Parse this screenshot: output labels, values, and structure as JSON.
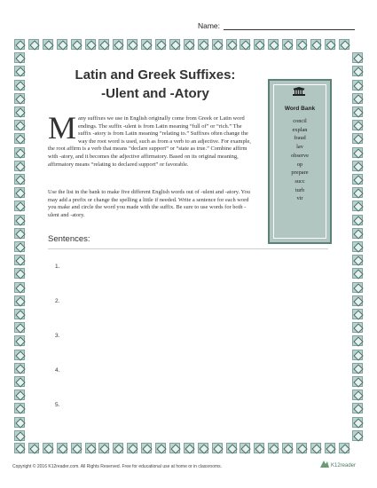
{
  "header": {
    "name_label": "Name:"
  },
  "title": {
    "line1": "Latin and Greek Suffixes:",
    "line2": "-Ulent and -Atory"
  },
  "intro": {
    "drop_cap": "M",
    "text": "any suffixes we use in English originally come from Greek or Latin word endings. The suffix -ulent is from Latin meaning “full of” or “rich.” The suffix -atory is from Latin meaning “relating to.” Suffixes often change the way the root word is used, such as from a verb to an adjective. For example, the root affirm is a verb that means “declare support” or “state as true.” Combine affirm with -atory, and it becomes the adjective affirmatory. Based on its original meaning, affirmatory means “relating to declared support” or favorable."
  },
  "instructions": "Use the list in the bank to make five different English words out of -ulent and -atory. You may add a prefix or change the spelling a little if needed. Write a sentence for each word you make and circle the word you made with the suffix. Be sure to use words for both -ulent and -atory.",
  "word_bank": {
    "title": "Word Bank",
    "icon": "bank-building-icon",
    "words": [
      "concil",
      "explan",
      "fraud",
      "lav",
      "observe",
      "op",
      "prepare",
      "succ",
      "turb",
      "vir"
    ]
  },
  "sentences": {
    "heading": "Sentences:",
    "numbers": [
      "1.",
      "2.",
      "3.",
      "4.",
      "5."
    ]
  },
  "footer": {
    "copyright": "Copyright © 2016 K12reader.com. All Rights Reserved. Free for educational use at home or in classrooms.",
    "logo_text": "K12reader"
  },
  "colors": {
    "tile": "#bcd1cd",
    "tile_border": "#7fa39d",
    "wordbank_bg": "#b2c6c1",
    "wordbank_border": "#5b8178"
  }
}
